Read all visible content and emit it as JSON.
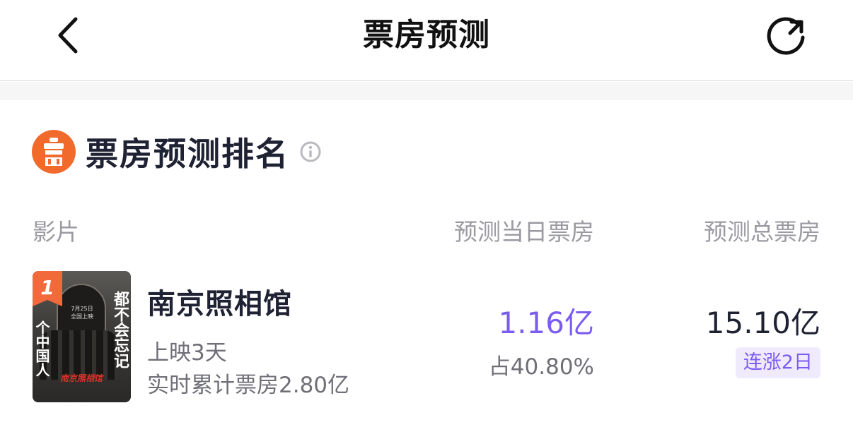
{
  "nav": {
    "title": "票房预测",
    "back_icon": "chevron-left-icon",
    "refresh_icon": "refresh-icon"
  },
  "section": {
    "title": "票房预测排名",
    "icon": "box-office-icon",
    "info_icon": "info-icon",
    "icon_color": "#f26a2b"
  },
  "columns": {
    "film": "影片",
    "today": "预测当日票房",
    "total": "预测总票房"
  },
  "rows": [
    {
      "rank": "1",
      "name": "南京照相馆",
      "days": "上映3天",
      "cumulative": "实时累计票房2.80亿",
      "today_value": "1.16亿",
      "today_share": "占40.80%",
      "total_value": "15.10亿",
      "trend": "连涨2日",
      "poster": {
        "tagline_right": "都不会忘记",
        "tagline_left": "个中国人",
        "date_line1": "7月25日",
        "date_line2": "全国上映",
        "title_red": "南京照相馆"
      }
    }
  ],
  "colors": {
    "accent": "#7b5cf0",
    "badge": "#f2693b",
    "muted": "#9a9aa2"
  }
}
